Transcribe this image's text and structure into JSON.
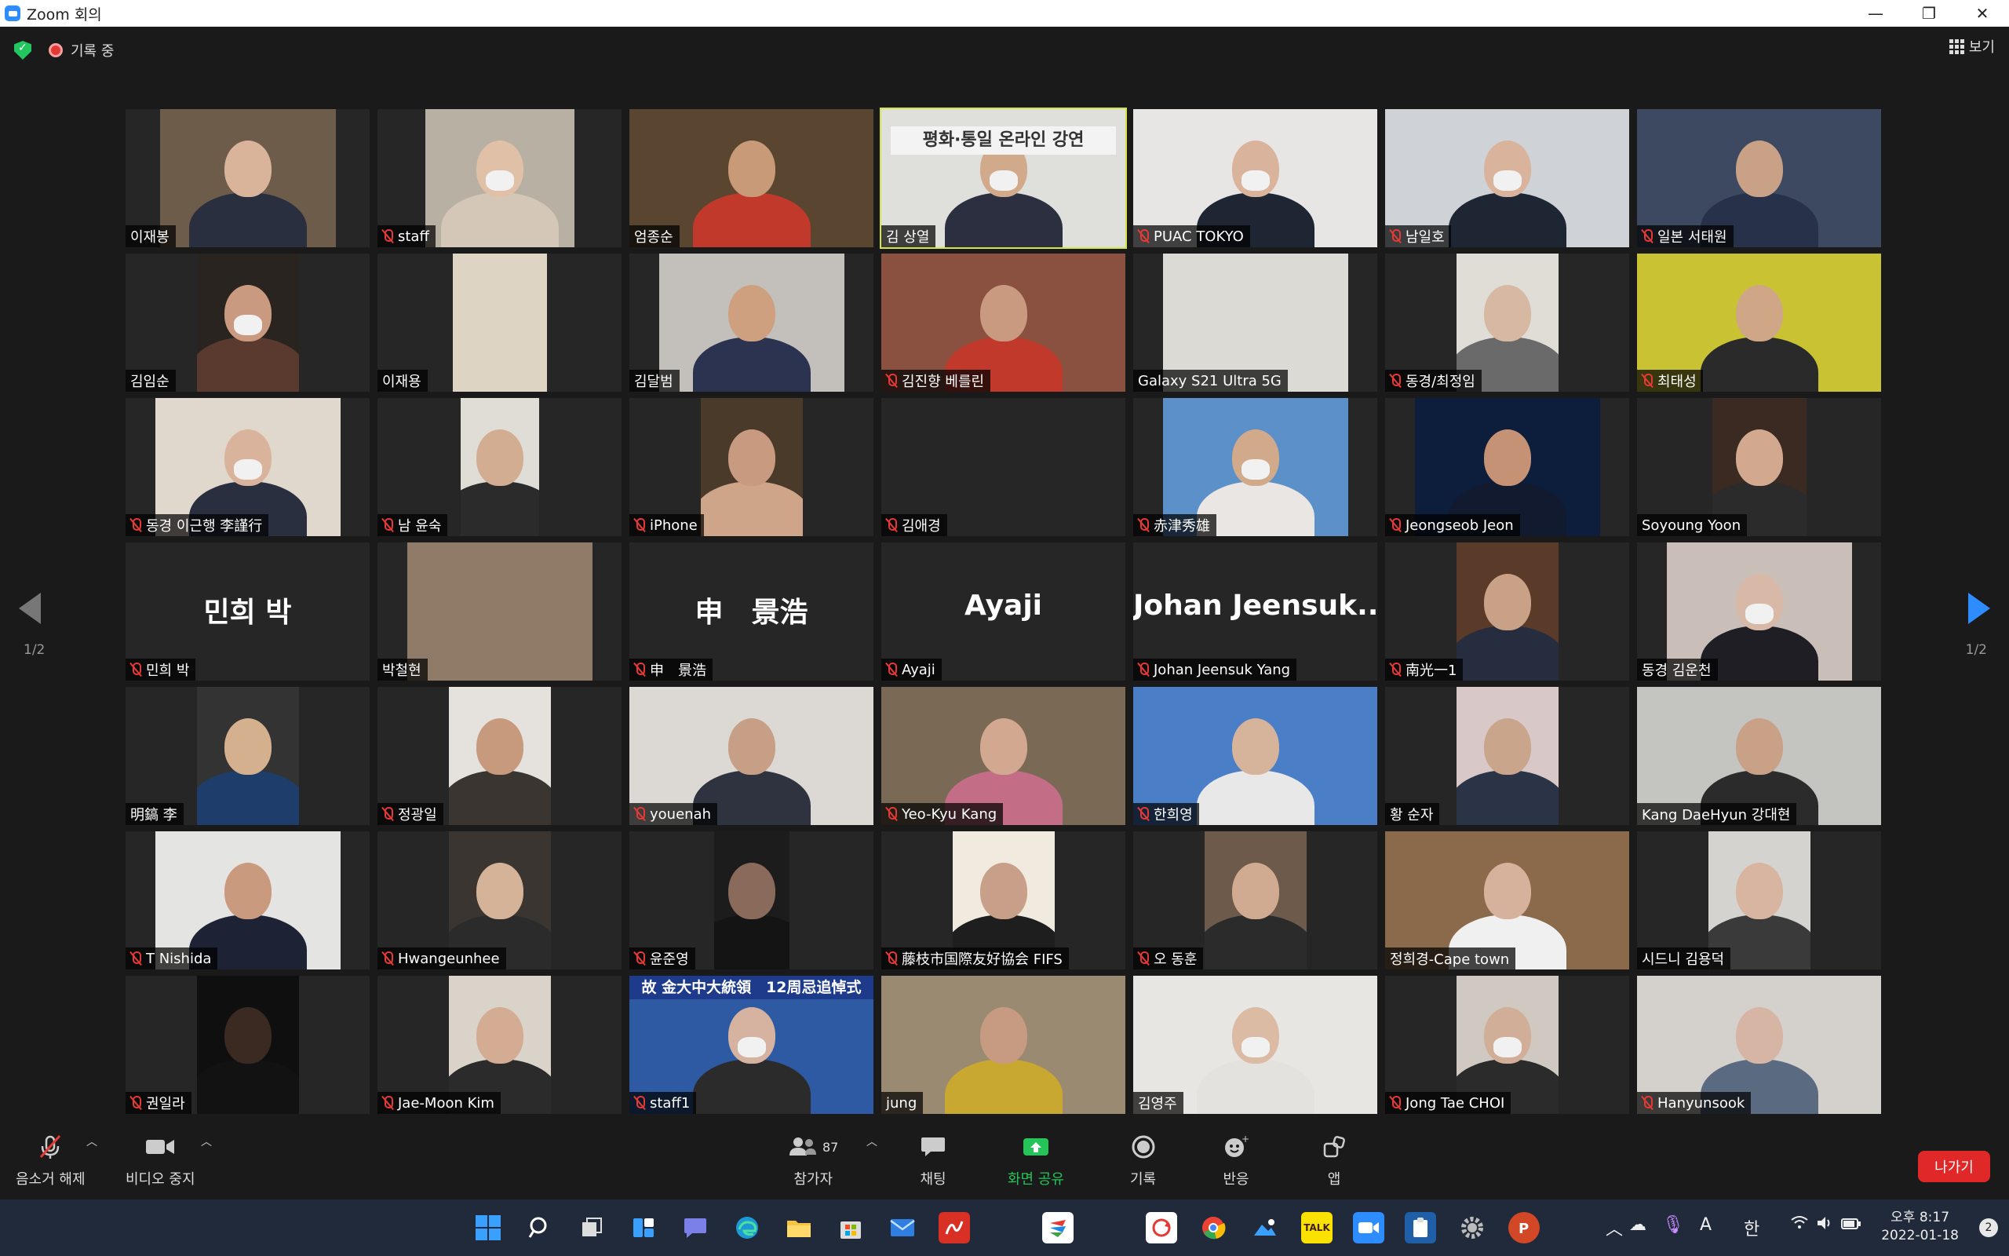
{
  "window": {
    "title": "Zoom 회의",
    "minimize": "—",
    "restore": "❐",
    "close": "✕"
  },
  "topbar": {
    "recording_label": "기록 중",
    "view_label": "보기"
  },
  "pagination": {
    "left": "1/2",
    "right": "1/2"
  },
  "participants": [
    {
      "name": "이재봉",
      "muted": false
    },
    {
      "name": "staff",
      "muted": true
    },
    {
      "name": "엄종순",
      "muted": false
    },
    {
      "name": "김 상열",
      "muted": false,
      "active": true,
      "sign": "평화·통일 온라인 강연"
    },
    {
      "name": "PUAC TOKYO",
      "muted": true
    },
    {
      "name": "남일호",
      "muted": true
    },
    {
      "name": "일본 서태원",
      "muted": true
    },
    {
      "name": "김임순",
      "muted": false
    },
    {
      "name": "이재용",
      "muted": false
    },
    {
      "name": "김달범",
      "muted": false
    },
    {
      "name": "김진향 베를린",
      "muted": true
    },
    {
      "name": "Galaxy S21 Ultra 5G",
      "muted": false
    },
    {
      "name": "동경/최정임",
      "muted": true
    },
    {
      "name": "최태성",
      "muted": true
    },
    {
      "name": "동경 이근행 李謹行",
      "muted": true
    },
    {
      "name": "남 윤숙",
      "muted": true
    },
    {
      "name": "iPhone",
      "muted": true
    },
    {
      "name": "김애경",
      "muted": true
    },
    {
      "name": "赤津秀雄",
      "muted": true
    },
    {
      "name": "Jeongseob Jeon",
      "muted": true
    },
    {
      "name": "Soyoung Yoon",
      "muted": false
    },
    {
      "name": "민희 박",
      "muted": true,
      "big": "민희 박"
    },
    {
      "name": "박철현",
      "muted": false
    },
    {
      "name": "申　景浩",
      "muted": true,
      "big": "申　景浩"
    },
    {
      "name": "Ayaji",
      "muted": true,
      "big": "Ayaji"
    },
    {
      "name": "Johan Jeensuk Yang",
      "muted": true,
      "big": "Johan  Jeensuk..."
    },
    {
      "name": "南光一1",
      "muted": true
    },
    {
      "name": "동경 김운천",
      "muted": false
    },
    {
      "name": "明鎬 李",
      "muted": false
    },
    {
      "name": "정광일",
      "muted": true
    },
    {
      "name": "youenah",
      "muted": true
    },
    {
      "name": "Yeo-Kyu Kang",
      "muted": true
    },
    {
      "name": "한희영",
      "muted": true
    },
    {
      "name": "황 순자",
      "muted": false
    },
    {
      "name": "Kang DaeHyun 강대현",
      "muted": false
    },
    {
      "name": "T Nishida",
      "muted": true
    },
    {
      "name": "Hwangeunhee",
      "muted": true
    },
    {
      "name": "윤준영",
      "muted": true
    },
    {
      "name": "藤枝市国際友好協会 FIFS",
      "muted": true
    },
    {
      "name": "오 동훈",
      "muted": true
    },
    {
      "name": "정희경-Cape town",
      "muted": false
    },
    {
      "name": "시드니 김용덕",
      "muted": false
    },
    {
      "name": "권일라",
      "muted": true
    },
    {
      "name": "Jae-Moon Kim",
      "muted": true
    },
    {
      "name": "staff1",
      "muted": true,
      "banner": "故 金大中大統領　12周忌追悼式"
    },
    {
      "name": "jung",
      "muted": false
    },
    {
      "name": "김영주",
      "muted": false
    },
    {
      "name": "Jong Tae CHOI",
      "muted": true
    },
    {
      "name": "Hanyunsook",
      "muted": true
    }
  ],
  "toolbar": {
    "unmute": "음소거 해제",
    "stop_video": "비디오 중지",
    "participants": "참가자",
    "participant_count": "87",
    "chat": "채팅",
    "share_screen": "화면 공유",
    "record": "기록",
    "reactions": "반응",
    "apps": "앱",
    "leave": "나가기"
  },
  "taskbar": {
    "ime_a": "A",
    "ime_han": "한",
    "time": "오후 8:17",
    "date": "2022-01-18",
    "notifications": "2",
    "kakao": "TALK"
  }
}
